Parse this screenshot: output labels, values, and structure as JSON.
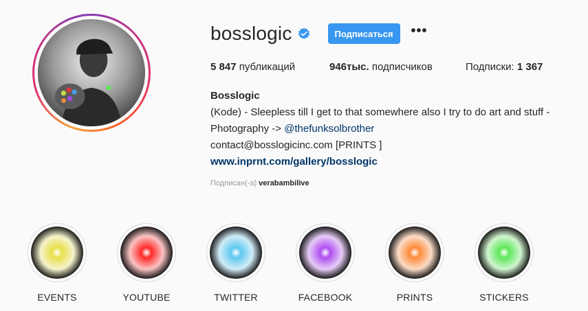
{
  "profile": {
    "username": "bosslogic",
    "verified": true,
    "follow_label": "Подписаться",
    "more_label": "•••"
  },
  "stats": {
    "posts_count": "5 847",
    "posts_label": "публикаций",
    "followers_count": "946тыс.",
    "followers_label": "подписчиков",
    "following_label": "Подписки:",
    "following_count": "1 367"
  },
  "bio": {
    "full_name": "Bosslogic",
    "line1": "(Kode) - Sleepless till I get to that somewhere also I try to do art and stuff -",
    "line2_prefix": "Photography -> ",
    "mention": "@thefunksolbrother",
    "line3": "contact@bosslogicinc.com [PRINTS ]",
    "website": "www.inprnt.com/gallery/bosslogic"
  },
  "followed_by": {
    "label": "Подписан(-а)",
    "user": "verabambilive"
  },
  "highlights": [
    {
      "label": "EVENTS",
      "color": "#e8e04a"
    },
    {
      "label": "YOUTUBE",
      "color": "#ff2a2a"
    },
    {
      "label": "TWITTER",
      "color": "#5ec8f0"
    },
    {
      "label": "FACEBOOK",
      "color": "#b04ef0"
    },
    {
      "label": "PRINTS",
      "color": "#ff8a3a"
    },
    {
      "label": "STICKERS",
      "color": "#5ee85a"
    }
  ],
  "colors": {
    "accent": "#3897f0",
    "link": "#003569",
    "text": "#262626",
    "muted": "#999999",
    "background": "#fafafa"
  }
}
